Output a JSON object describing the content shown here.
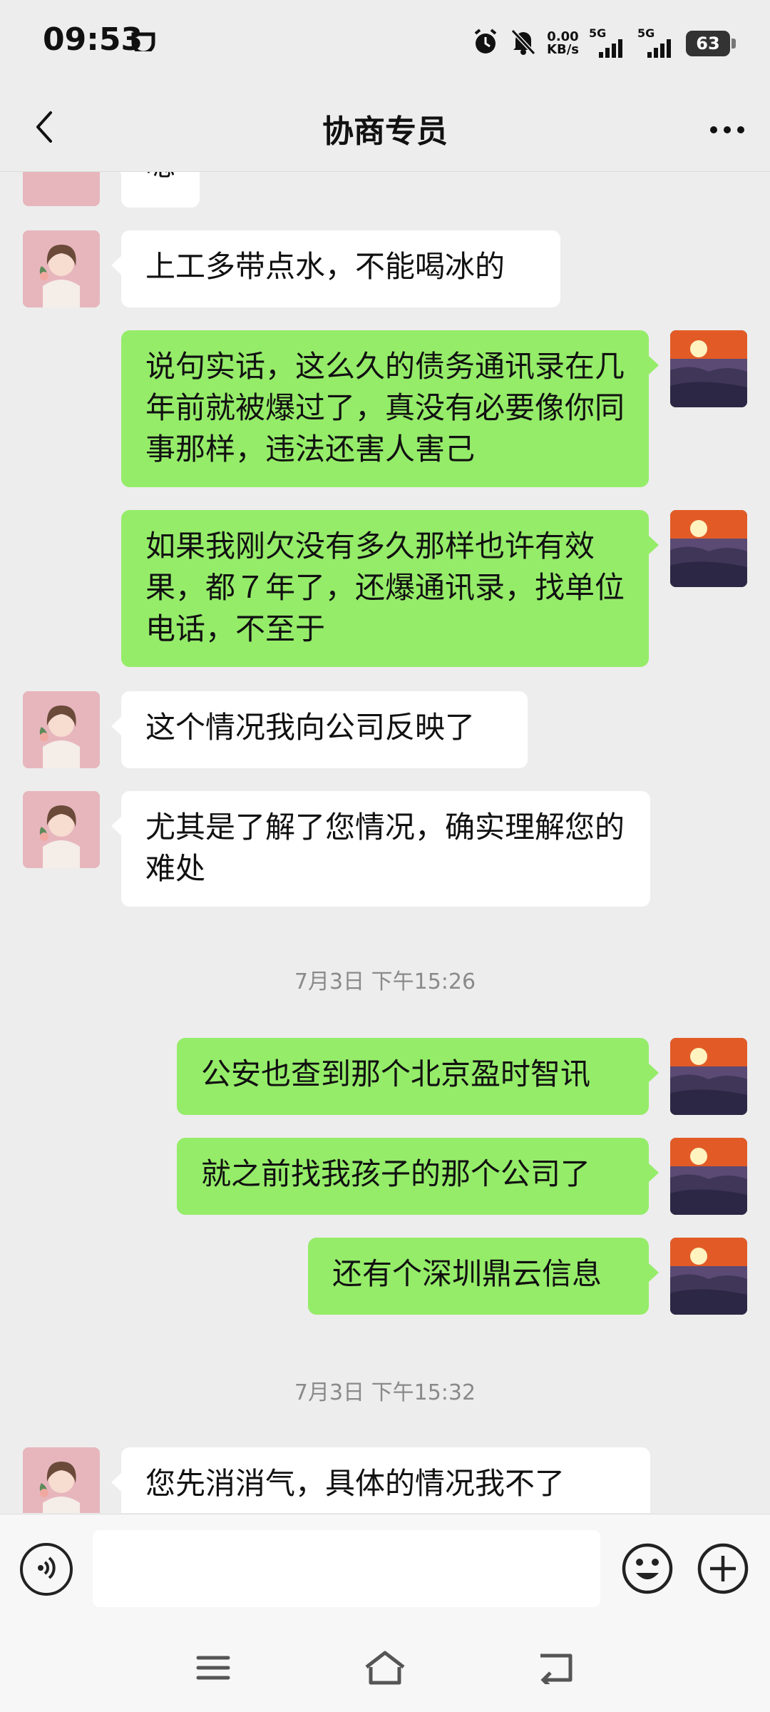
{
  "status_bar": {
    "time": "09:53",
    "net_speed": "0.00",
    "net_unit": "KB/s",
    "sim1": "5G",
    "sim2": "5G",
    "battery": "63"
  },
  "header": {
    "title": "协商专员"
  },
  "messages": [
    {
      "side": "in",
      "text": "嗯"
    },
    {
      "side": "in",
      "text": "上工多带点水，不能喝冰的"
    },
    {
      "side": "out",
      "text": "说句实话，这么久的债务通讯录在几年前就被爆过了，真没有必要像你同事那样，违法还害人害己"
    },
    {
      "side": "out",
      "text": "如果我刚欠没有多久那样也许有效果，都７年了，还爆通讯录，找单位电话，不至于"
    },
    {
      "side": "in",
      "text": "这个情况我向公司反映了"
    },
    {
      "side": "in",
      "text": "尤其是了解了您情况，确实理解您的难处"
    },
    {
      "side": "out",
      "text": "公安也查到那个北京盈时智讯"
    },
    {
      "side": "out",
      "text": "就之前找我孩子的那个公司了"
    },
    {
      "side": "out",
      "text": "还有个深圳鼎云信息"
    },
    {
      "side": "in",
      "text": "您先消消气，具体的情况我不了"
    }
  ],
  "timestamps": [
    "7月3日 下午15:26",
    "7月3日 下午15:32"
  ],
  "input": {
    "value": "",
    "placeholder": ""
  },
  "colors": {
    "background": "#ededed",
    "outgoing_bubble": "#95ec69",
    "incoming_bubble": "#ffffff"
  },
  "icons": {
    "back": "chevron-left-icon",
    "more": "more-dots-icon",
    "voice": "voice-icon",
    "emoji": "emoji-icon",
    "plus": "plus-icon",
    "nav_menu": "menu-icon",
    "nav_home": "home-icon",
    "nav_back": "back-arrow-icon"
  }
}
